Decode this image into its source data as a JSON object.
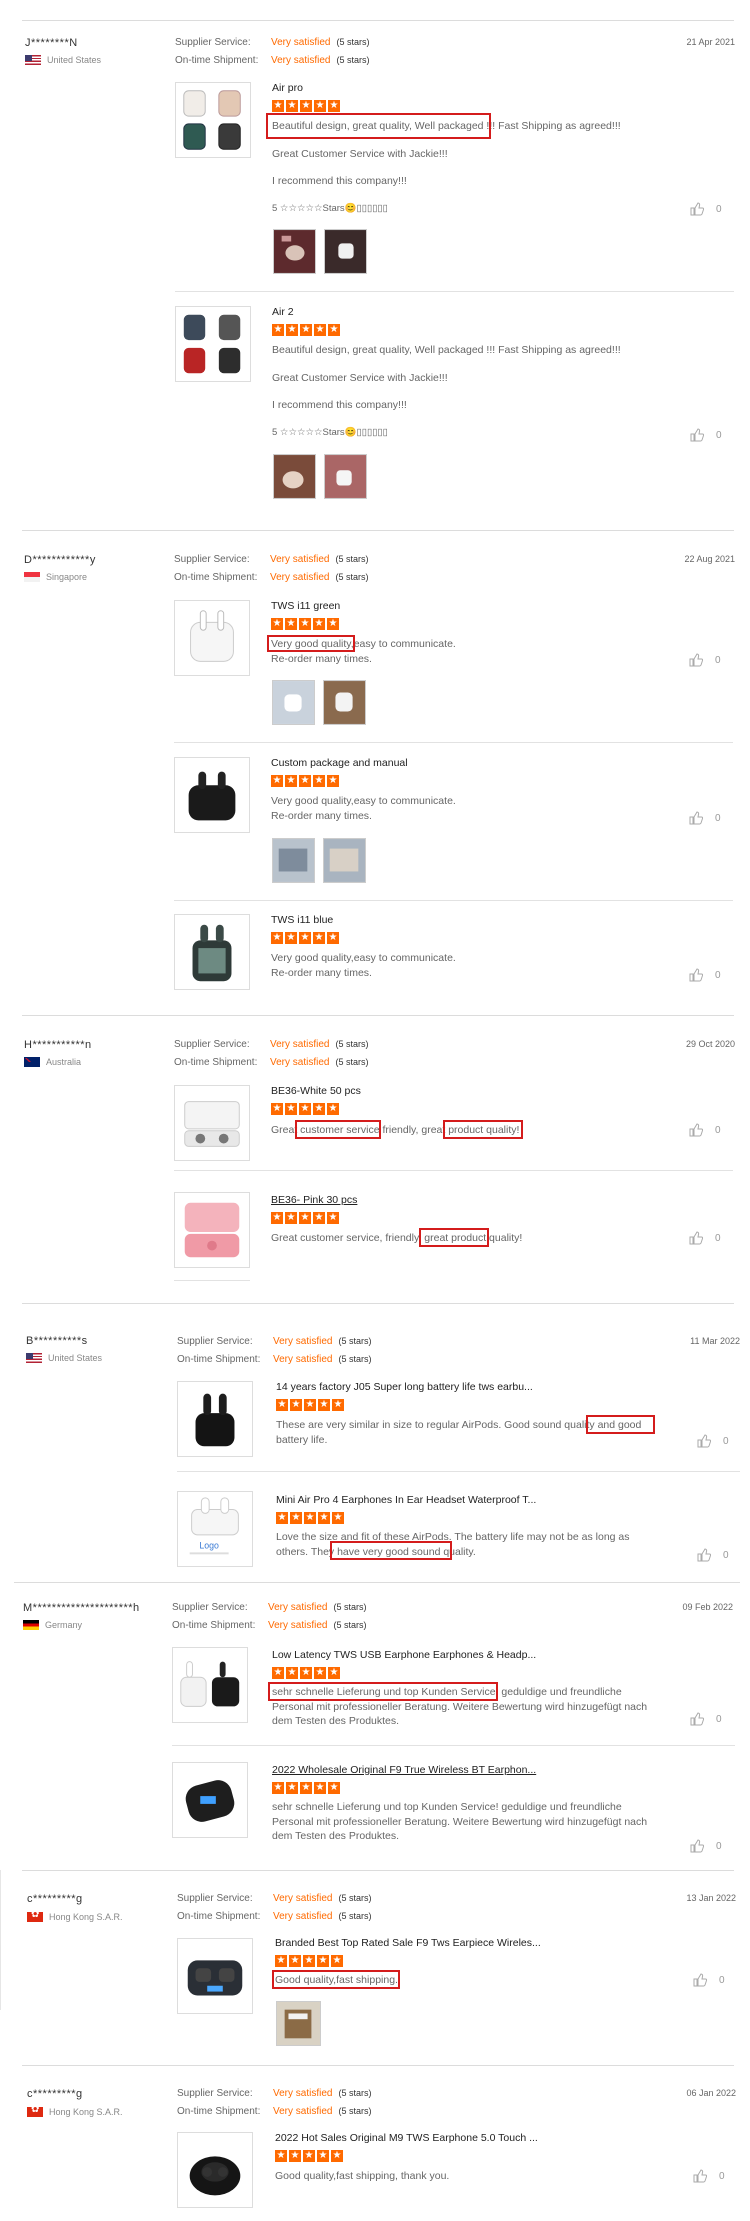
{
  "labels": {
    "supplier_service": "Supplier Service:",
    "ontime_shipment": "On-time Shipment:",
    "satisfied": "Very satisfied",
    "five_stars": "(5 stars)"
  },
  "colors": {
    "accent": "#ff6a00",
    "highlight_box": "#d41c1c"
  },
  "reviews": [
    {
      "buyer": "J********N",
      "country": "United States",
      "flag": "us",
      "date": "21 Apr 2021",
      "items": [
        {
          "title": "Air pro",
          "lines": [
            "Beautiful design, great quality, Well packaged !!! Fast Shipping as agreed!!!",
            "Great Customer Service with Jackie!!!",
            "I recommend this company!!!",
            "5 ☆☆☆☆☆Stars😊▯▯▯▯▯▯"
          ],
          "highlight": "Beautiful design, great quality, Well packaged !!!",
          "likes": "0",
          "photos": 2
        },
        {
          "title": "Air 2",
          "lines": [
            "Beautiful design, great quality, Well packaged !!! Fast Shipping as agreed!!!",
            "Great Customer Service with Jackie!!!",
            "I recommend this company!!!",
            "5 ☆☆☆☆☆Stars😊▯▯▯▯▯▯"
          ],
          "likes": "0",
          "photos": 2
        }
      ]
    },
    {
      "buyer": "D************y",
      "country": "Singapore",
      "flag": "sg",
      "date": "22 Aug 2021",
      "items": [
        {
          "title": "TWS i11 green",
          "lines": [
            "Very good quality,easy to communicate.",
            "Re-order many times."
          ],
          "likes": "0",
          "photos": 2
        },
        {
          "title": "Custom package and manual",
          "lines": [
            "Very good quality,easy to communicate.",
            "Re-order many times."
          ],
          "likes": "0",
          "photos": 2
        },
        {
          "title": "TWS i11 blue",
          "lines": [
            "Very good quality,easy to communicate.",
            "Re-order many times."
          ],
          "likes": "0",
          "photos": 0
        }
      ]
    },
    {
      "buyer": "H***********n",
      "country": "Australia",
      "flag": "au",
      "date": "29 Oct 2020",
      "items": [
        {
          "title": "BE36-White 50 pcs",
          "lines": [
            "Great customer service friendly, great product quality!"
          ],
          "likes": "0",
          "photos": 0
        },
        {
          "title": "BE36- Pink 30 pcs",
          "lines": [
            "Great customer service, friendly, great product quality!"
          ],
          "likes": "0",
          "photos": 0
        }
      ]
    },
    {
      "buyer": "B**********s",
      "country": "United States",
      "flag": "us",
      "date": "11 Mar 2022",
      "items": [
        {
          "title": "14 years factory J05 Super long battery life tws earbu...",
          "lines": [
            "These are very similar in size to regular AirPods. Good sound quality and good battery life."
          ],
          "likes": "0",
          "photos": 0
        },
        {
          "title": "Mini Air Pro 4 Earphones In Ear Headset Waterproof T...",
          "lines": [
            "Love the size and fit of these AirPods. The battery life may not be as long as others. They have very good sound quality."
          ],
          "likes": "0",
          "photos": 0
        }
      ]
    },
    {
      "buyer": "M*********************h",
      "country": "Germany",
      "flag": "de",
      "date": "09 Feb 2022",
      "items": [
        {
          "title": "Low Latency TWS USB Earphone Earphones & Headp...",
          "lines": [
            "sehr schnelle Lieferung und top Kunden Service! geduldige und freundliche Personal mit professioneller Beratung. Weitere Bewertung wird hinzugefügt nach dem Testen des Produktes."
          ],
          "likes": "0",
          "photos": 0
        },
        {
          "title": "2022 Wholesale Original F9 True Wireless BT Earphon...",
          "lines": [
            "sehr schnelle Lieferung und top Kunden Service! geduldige und freundliche Personal mit professioneller Beratung. Weitere Bewertung wird hinzugefügt nach dem Testen des Produktes."
          ],
          "likes": "0",
          "photos": 0
        }
      ]
    },
    {
      "buyer": "c*********g",
      "country": "Hong Kong S.A.R.",
      "flag": "hk",
      "date": "13 Jan 2022",
      "items": [
        {
          "title": "Branded Best Top Rated Sale F9 Tws Earpiece Wireles...",
          "lines": [
            "Good quality,fast shipping."
          ],
          "likes": "0",
          "photos": 1
        }
      ]
    },
    {
      "buyer": "c*********g",
      "country": "Hong Kong S.A.R.",
      "flag": "hk",
      "date": "06 Jan 2022",
      "items": [
        {
          "title": "2022 Hot Sales Original M9 TWS Earphone 5.0 Touch ...",
          "lines": [
            "Good quality,fast shipping, thank you."
          ],
          "likes": "0",
          "photos": 0
        }
      ]
    }
  ]
}
